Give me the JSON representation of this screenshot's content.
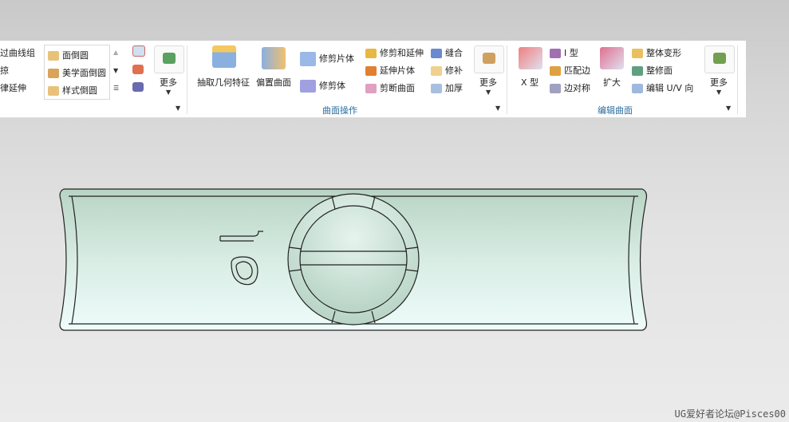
{
  "ribbon": {
    "left_group": {
      "items": [
        "过曲线组",
        "掠",
        "律延伸"
      ],
      "gallery": [
        "面倒圆",
        "美学面倒圆",
        "样式倒圆"
      ],
      "more_label": "更多"
    },
    "surface_ops": {
      "large": [
        "抽取几何特征",
        "偏置曲面"
      ],
      "col1": [
        "修剪片体",
        "修剪体"
      ],
      "col2": [
        "修剪和延伸",
        "延伸片体",
        "剪断曲面"
      ],
      "col3": [
        "缝合",
        "修补",
        "加厚"
      ],
      "more_label": "更多",
      "group_label": "曲面操作"
    },
    "edit_surface": {
      "x_type": "X 型",
      "col1": [
        "I 型",
        "匹配边",
        "边对称"
      ],
      "expand": "扩大",
      "col2": [
        "整体变形",
        "整修面",
        "编辑 U/V 向"
      ],
      "more_label": "更多",
      "group_label": "编辑曲面"
    }
  },
  "watermark": "UG爱好者论坛@Pisces00"
}
